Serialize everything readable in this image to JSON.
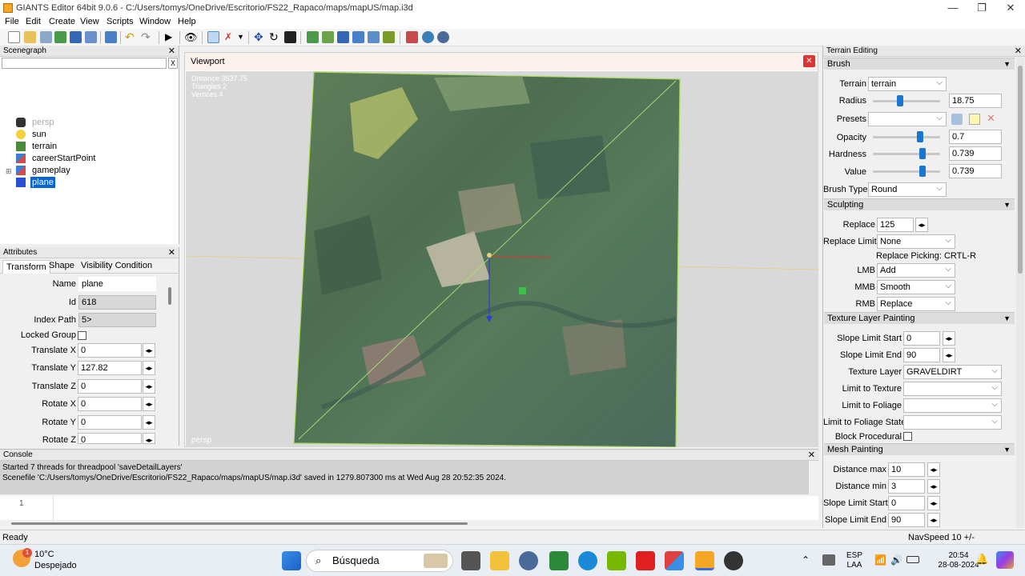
{
  "window": {
    "title": "GIANTS Editor 64bit 9.0.6 - C:/Users/tomys/OneDrive/Escritorio/FS22_Rapaco/maps/mapUS/map.i3d"
  },
  "menu": [
    "File",
    "Edit",
    "Create",
    "View",
    "Scripts",
    "Window",
    "Help"
  ],
  "scenegraph": {
    "title": "Scenegraph",
    "search_x": "X",
    "items": [
      {
        "label": "persp",
        "icon": "camera-icon"
      },
      {
        "label": "sun",
        "icon": "light-bulb-icon"
      },
      {
        "label": "terrain",
        "icon": "terrain-icon"
      },
      {
        "label": "careerStartPoint",
        "icon": "transform-group-icon"
      },
      {
        "label": "gameplay",
        "icon": "transform-group-icon"
      },
      {
        "label": "plane",
        "icon": "shape-cube-icon"
      }
    ]
  },
  "attributes": {
    "title": "Attributes",
    "tabs": [
      "Transform",
      "Shape",
      "Visibility Condition"
    ],
    "labels": {
      "name": "Name",
      "id": "Id",
      "index_path": "Index Path",
      "locked_group": "Locked Group",
      "tx": "Translate X",
      "ty": "Translate Y",
      "tz": "Translate Z",
      "rx": "Rotate X",
      "ry": "Rotate Y",
      "rz": "Rotate Z"
    },
    "values": {
      "name": "plane",
      "id": "618",
      "index_path": "5>",
      "tx": "0",
      "ty": "127.82",
      "tz": "0",
      "rx": "0",
      "ry": "0",
      "rz": "0"
    }
  },
  "viewport": {
    "title": "Viewport",
    "info": [
      "Distance 3537.75",
      "Triangles 2",
      "Vertices 4"
    ],
    "camera": "persp"
  },
  "console": {
    "title": "Console",
    "lines": [
      "Started 7 threads for threadpool 'saveDetailLayers'",
      "Scenefile 'C:/Users/tomys/OneDrive/Escritorio/FS22_Rapaco/maps/mapUS/map.i3d' saved in 1279.807300 ms at Wed Aug 28 20:52:35 2024."
    ],
    "line_number": "1"
  },
  "status": {
    "left": "Ready",
    "right": "NavSpeed 10 +/-"
  },
  "terrain_editing": {
    "title": "Terrain Editing",
    "brush": {
      "title": "Brush",
      "terrain_label": "Terrain",
      "terrain_value": "terrain",
      "radius_label": "Radius",
      "radius_value": "18.75",
      "radius_level": 0.4,
      "presets_label": "Presets",
      "opacity_label": "Opacity",
      "opacity_value": "0.7",
      "opacity_level": 0.7,
      "hardness_label": "Hardness",
      "hardness_value": "0.739",
      "hardness_level": 0.739,
      "value_label": "Value",
      "value_value": "0.739",
      "value_level": 0.739,
      "brush_type_label": "Brush Type",
      "brush_type_value": "Round"
    },
    "sculpting": {
      "title": "Sculpting",
      "replace_label": "Replace",
      "replace_value": "125",
      "replace_limit_label": "Replace Limit",
      "replace_limit_value": "None",
      "replace_picking": "Replace Picking: CRTL-R",
      "lmb_label": "LMB",
      "lmb_value": "Add",
      "mmb_label": "MMB",
      "mmb_value": "Smooth",
      "rmb_label": "RMB",
      "rmb_value": "Replace"
    },
    "texture": {
      "title": "Texture Layer Painting",
      "slope_start_label": "Slope Limit Start",
      "slope_start_value": "0",
      "slope_end_label": "Slope Limit End",
      "slope_end_value": "90",
      "layer_label": "Texture Layer",
      "layer_value": "GRAVELDIRT",
      "limit_texture_label": "Limit to Texture",
      "limit_foliage_label": "Limit to Foliage",
      "limit_foliage_state_label": "Limit to Foliage State",
      "block_procedural_label": "Block Procedural"
    },
    "mesh": {
      "title": "Mesh Painting",
      "dmax_label": "Distance max",
      "dmax_value": "10",
      "dmin_label": "Distance min",
      "dmin_value": "3",
      "slope_start_label": "Slope Limit Start",
      "slope_start_value": "0",
      "slope_end_label": "Slope Limit End",
      "slope_end_value": "90"
    }
  },
  "taskbar": {
    "weather_temp": "10°C",
    "weather_desc": "Despejado",
    "weather_badge": "1",
    "search_label": "Búsqueda",
    "lang_1": "ESP",
    "lang_2": "LAA",
    "time": "20:54",
    "date": "28-08-2024"
  }
}
